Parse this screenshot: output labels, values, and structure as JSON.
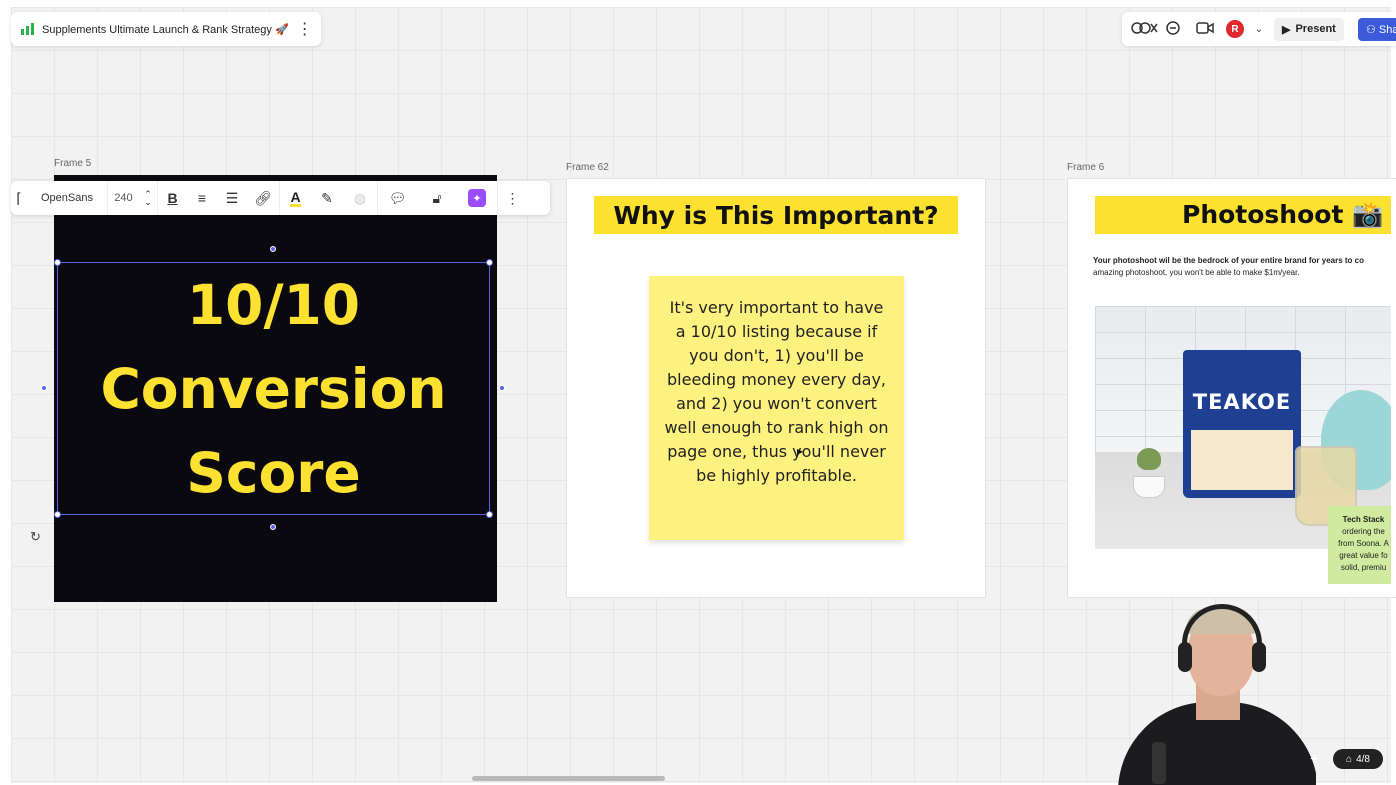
{
  "board": {
    "title": "Supplements Ultimate Launch & Rank Strategy 🚀",
    "more_icon": "⋮"
  },
  "topbar": {
    "reactions_icon": "reactions-icon",
    "comments_icon": "comments-icon",
    "video_icon": "video-icon",
    "avatar_initial": "R",
    "present_label": "Present",
    "share_label": "Sha"
  },
  "text_toolbar": {
    "font": "OpenSans",
    "font_size": "240"
  },
  "frames": [
    {
      "label": "Frame 5",
      "text": "10/10 Conversion Score"
    },
    {
      "label": "Frame 62",
      "heading": "Why is This Important?",
      "sticky": "It's very important to have a 10/10 listing because if you don't, 1) you'll be bleeding money every day, and 2) you won't convert well enough to rank high on page one, thus you'll never be highly profitable."
    },
    {
      "label": "Frame 6",
      "heading": "Photoshoot 📸",
      "subtitle_bold": "Your photoshoot wil be the bedrock of your entire brand for years to co",
      "subtitle_rest": "amazing photoshoot, you won't be able to make $1m/year.",
      "product_brand": "TEAKOE",
      "green_sticky": [
        "Tech Stack",
        "ordering the",
        "from Soona. A",
        "great value fo",
        "solid, premiu"
      ]
    }
  ],
  "footer": {
    "page_counter": "4/8"
  },
  "colors": {
    "accent_yellow": "#fde130",
    "sticky_yellow": "#fdf17f",
    "selection_blue": "#5865e8",
    "share_blue": "#3b5bdb"
  }
}
